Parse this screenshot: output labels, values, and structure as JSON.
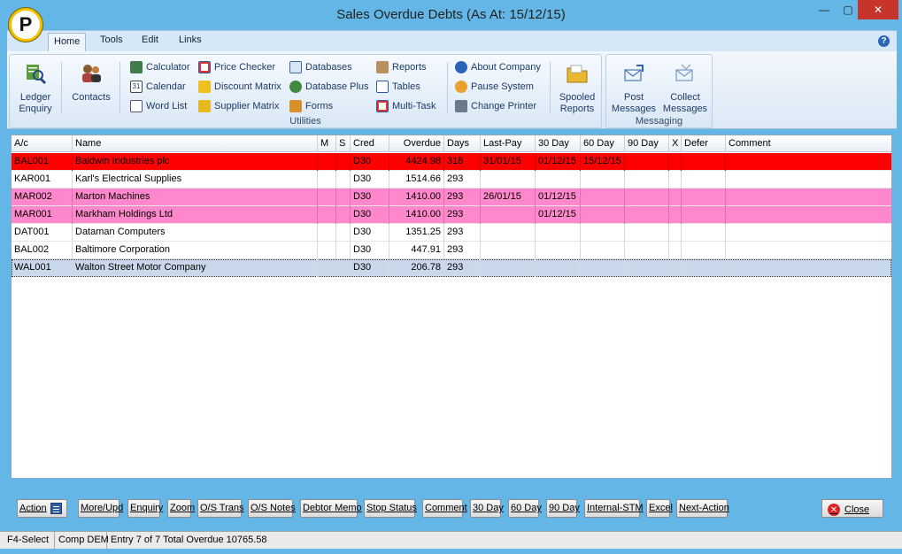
{
  "window": {
    "title": "Sales Overdue Debts (As At: 15/12/15)",
    "logo_letter": "P",
    "min_glyph": "—",
    "max_glyph": "▢",
    "close_glyph": "✕"
  },
  "ribbon_tabs": [
    "Home",
    "Tools",
    "Edit",
    "Links"
  ],
  "help_glyph": "?",
  "ribbon": {
    "ledger_enquiry": "Ledger\nEnquiry",
    "contacts": "Contacts",
    "calculator": "Calculator",
    "calendar": "Calendar",
    "word_list": "Word List",
    "price_checker": "Price Checker",
    "discount_matrix": "Discount Matrix",
    "supplier_matrix": "Supplier Matrix",
    "databases": "Databases",
    "database_plus": "Database Plus",
    "forms": "Forms",
    "reports": "Reports",
    "tables": "Tables",
    "multi_task": "Multi-Task",
    "about_company": "About Company",
    "pause_system": "Pause System",
    "change_printer": "Change Printer",
    "spooled_reports": "Spooled\nReports",
    "post_messages": "Post\nMessages",
    "collect_messages": "Collect\nMessages",
    "utilities_label": "Utilities",
    "messaging_label": "Messaging",
    "calendar_day": "31"
  },
  "grid": {
    "columns": [
      "A/c",
      "Name",
      "M",
      "S",
      "Cred",
      "Overdue",
      "Days",
      "Last-Pay",
      "30 Day",
      "60 Day",
      "90 Day",
      "X",
      "Defer",
      "Comment"
    ],
    "rows": [
      {
        "ac": "BAL001",
        "name": "Baldwin Industries plc",
        "cred": "D30",
        "overdue": "4424.98",
        "days": "318",
        "last_pay": "31/01/15",
        "d30": "01/12/15",
        "d60": "15/12/15",
        "d90": ""
      },
      {
        "ac": "KAR001",
        "name": "Karl's Electrical Supplies",
        "cred": "D30",
        "overdue": "1514.66",
        "days": "293",
        "last_pay": "",
        "d30": "",
        "d60": "",
        "d90": ""
      },
      {
        "ac": "MAR002",
        "name": "Marton Machines",
        "cred": "D30",
        "overdue": "1410.00",
        "days": "293",
        "last_pay": "26/01/15",
        "d30": "01/12/15",
        "d60": "",
        "d90": ""
      },
      {
        "ac": "MAR001",
        "name": "Markham Holdings Ltd",
        "cred": "D30",
        "overdue": "1410.00",
        "days": "293",
        "last_pay": "",
        "d30": "01/12/15",
        "d60": "",
        "d90": ""
      },
      {
        "ac": "DAT001",
        "name": "Dataman Computers",
        "cred": "D30",
        "overdue": "1351.25",
        "days": "293",
        "last_pay": "",
        "d30": "",
        "d60": "",
        "d90": ""
      },
      {
        "ac": "BAL002",
        "name": "Baltimore Corporation",
        "cred": "D30",
        "overdue": "447.91",
        "days": "293",
        "last_pay": "",
        "d30": "",
        "d60": "",
        "d90": ""
      },
      {
        "ac": "WAL001",
        "name": "Walton Street Motor Company",
        "cred": "D30",
        "overdue": "206.78",
        "days": "293",
        "last_pay": "",
        "d30": "",
        "d60": "",
        "d90": ""
      }
    ],
    "row_colors": {
      "red": "#ff0000",
      "pink": "#ff88cc",
      "selected": "#cad8ec"
    }
  },
  "actions": [
    "Action",
    "More/Upd",
    "Enquiry",
    "Zoom",
    "O/S Trans",
    "O/S Notes",
    "Debtor Memo",
    "Stop Status",
    "Comment",
    "30 Day",
    "60 Day",
    "90 Day",
    "Internal-STM",
    "Excel",
    "Next-Action"
  ],
  "close_button": "Close",
  "status": {
    "f4": "F4-Select",
    "comp": "Comp DEM",
    "entry": "Entry 7 of 7 Total Overdue 10765.58"
  }
}
